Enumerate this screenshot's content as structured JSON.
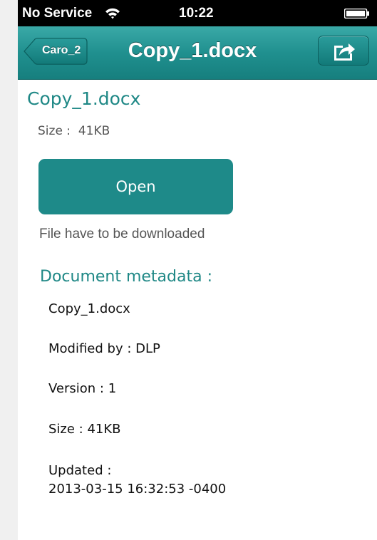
{
  "status_bar": {
    "carrier": "No Service",
    "time": "10:22",
    "icons": [
      "wifi-icon",
      "battery-icon"
    ]
  },
  "nav": {
    "back_label": "Caro_2",
    "title": "Copy_1.docx",
    "share_icon": "share-icon"
  },
  "file": {
    "title": "Copy_1.docx",
    "size_text": "Size :  41KB",
    "open_label": "Open",
    "download_note": "File have to be downloaded"
  },
  "metadata": {
    "heading": "Document metadata :",
    "name": "Copy_1.docx",
    "modified_by": "Modified by : DLP",
    "version": "Version : 1",
    "size": "Size : 41KB",
    "updated_label": "Updated :",
    "updated_value": "2013-03-15 16:32:53 -0400"
  },
  "colors": {
    "accent": "#1f8886",
    "nav_bar": "#20908f",
    "button": "#1e8a89"
  }
}
